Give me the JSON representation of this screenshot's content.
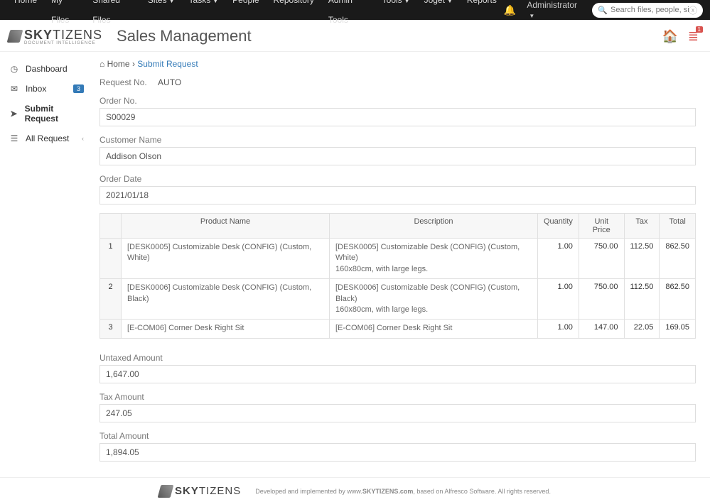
{
  "topnav": {
    "items": [
      {
        "label": "Home",
        "dropdown": false
      },
      {
        "label": "My Files",
        "dropdown": false
      },
      {
        "label": "Shared Files",
        "dropdown": false
      },
      {
        "label": "Sites",
        "dropdown": true
      },
      {
        "label": "Tasks",
        "dropdown": true
      },
      {
        "label": "People",
        "dropdown": false
      },
      {
        "label": "Repository",
        "dropdown": false
      },
      {
        "label": "Admin Tools",
        "dropdown": false
      },
      {
        "label": "Tools",
        "dropdown": true
      },
      {
        "label": "Joget",
        "dropdown": true
      },
      {
        "label": "Reports",
        "dropdown": false
      }
    ],
    "user": "Administrator",
    "search_placeholder": "Search files, people, sites"
  },
  "brand": {
    "name_pre": "SKY",
    "name_post": "TIZENS",
    "tagline": "DOCUMENT INTELLIGENCE"
  },
  "page_title": "Sales Management",
  "header_badge": "1",
  "sidebar": {
    "items": [
      {
        "icon": "◷",
        "label": "Dashboard"
      },
      {
        "icon": "✉",
        "label": "Inbox",
        "badge": "3"
      },
      {
        "icon": "➤",
        "label": "Submit Request",
        "active": true
      },
      {
        "icon": "☰",
        "label": "All Request",
        "caret": true
      }
    ]
  },
  "breadcrumb": {
    "home_icon": "⌂",
    "home_label": "Home",
    "current": "Submit Request"
  },
  "request_no": {
    "label": "Request No.",
    "value": "AUTO"
  },
  "fields": {
    "order_no": {
      "label": "Order No.",
      "value": "S00029"
    },
    "customer": {
      "label": "Customer Name",
      "value": "Addison Olson"
    },
    "order_date": {
      "label": "Order Date",
      "value": "2021/01/18"
    },
    "untaxed": {
      "label": "Untaxed Amount",
      "value": "1,647.00"
    },
    "tax": {
      "label": "Tax Amount",
      "value": "247.05"
    },
    "total": {
      "label": "Total Amount",
      "value": "1,894.05"
    }
  },
  "table": {
    "headers": [
      "",
      "Product Name",
      "Description",
      "Quantity",
      "Unit Price",
      "Tax",
      "Total"
    ],
    "rows": [
      {
        "idx": "1",
        "product": "[DESK0005] Customizable Desk (CONFIG) (Custom, White)",
        "desc": "[DESK0005] Customizable Desk (CONFIG) (Custom, White)\n160x80cm, with large legs.",
        "qty": "1.00",
        "price": "750.00",
        "tax": "112.50",
        "total": "862.50"
      },
      {
        "idx": "2",
        "product": "[DESK0006] Customizable Desk (CONFIG) (Custom, Black)",
        "desc": "[DESK0006] Customizable Desk (CONFIG) (Custom, Black)\n160x80cm, with large legs.",
        "qty": "1.00",
        "price": "750.00",
        "tax": "112.50",
        "total": "862.50"
      },
      {
        "idx": "3",
        "product": "[E-COM06] Corner Desk Right Sit",
        "desc": "[E-COM06] Corner Desk Right Sit",
        "qty": "1.00",
        "price": "147.00",
        "tax": "22.05",
        "total": "169.05"
      }
    ]
  },
  "footer": {
    "text_pre": "Developed and implemented by www.",
    "link": "SKYTIZENS.com",
    "text_post": ", based on Alfresco Software. All rights reserved."
  }
}
